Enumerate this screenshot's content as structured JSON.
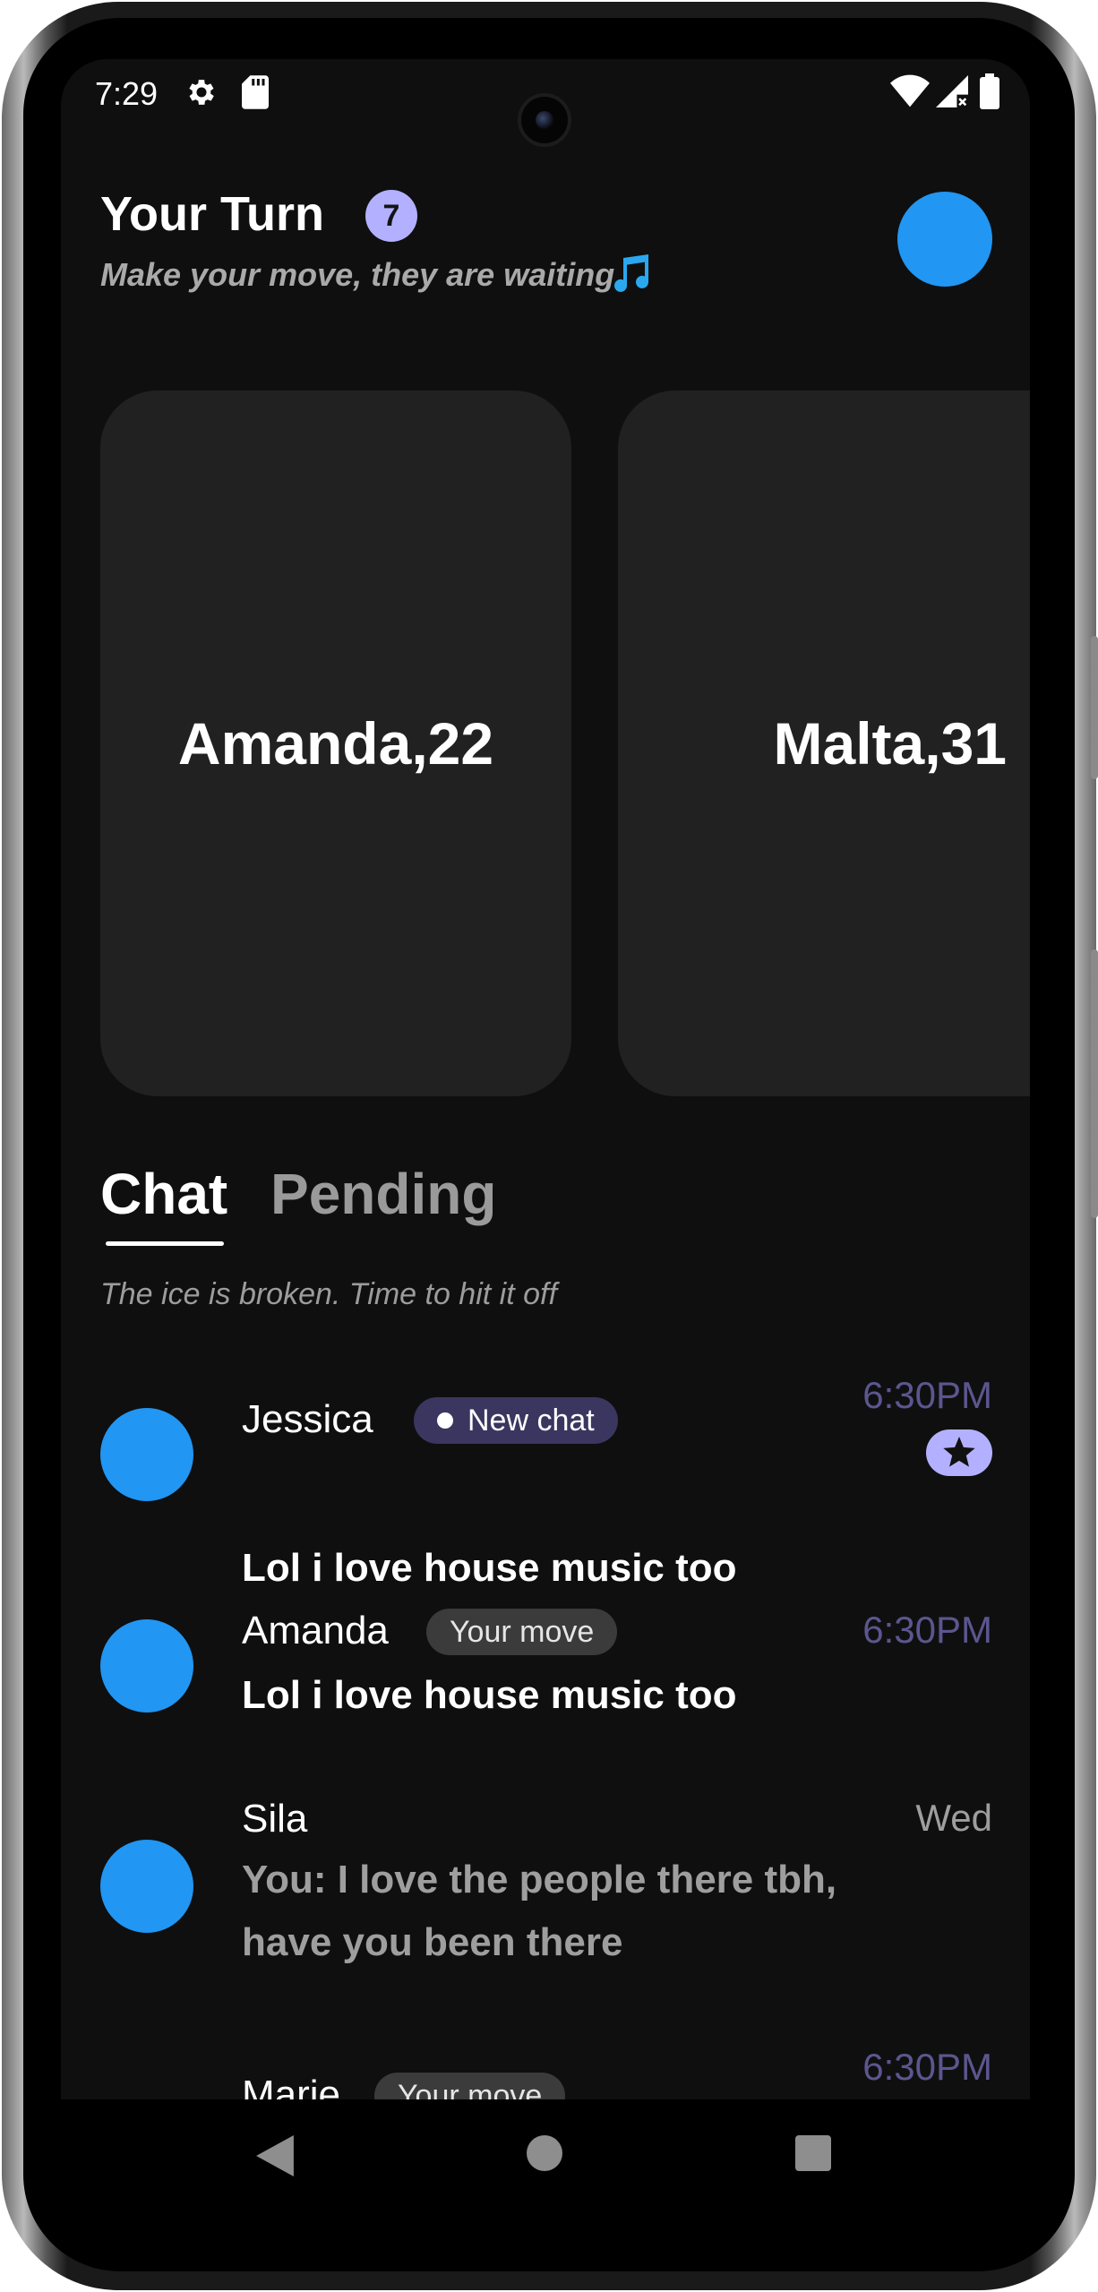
{
  "status_bar": {
    "time": "7:29",
    "icons": [
      "settings-gear-icon",
      "sd-card-icon",
      "wifi-icon",
      "cellular-signal-icon",
      "battery-icon"
    ]
  },
  "header": {
    "title": "Your Turn",
    "count": "7",
    "subtitle": "Make your move, they are waiting",
    "subtitle_icon": "music-note-icon"
  },
  "cards": [
    {
      "name": "Amanda,22"
    },
    {
      "name": "Malta,31"
    }
  ],
  "tabs": {
    "chat": "Chat",
    "pending": "Pending",
    "active": "Chat",
    "hint": "The ice is broken. Time to hit it off"
  },
  "chats": [
    {
      "name": "Jessica",
      "badge": "New chat",
      "message": "Lol i love house music too",
      "time": "6:30PM",
      "starred": true
    },
    {
      "name": "Amanda",
      "badge": "Your move",
      "message": "Lol i love house music too",
      "time": "6:30PM"
    },
    {
      "name": "Sila",
      "message_line1": "You: I love the people there tbh,",
      "message_line2": "have you been there",
      "time": "Wed"
    },
    {
      "name": "Marie",
      "badge": "Your move",
      "time": "6:30PM"
    }
  ],
  "colors": {
    "accent_blue": "#2196f3",
    "badge_lavender": "#b3b0ff",
    "time_purple": "#5b568f",
    "background": "#0f0f0f",
    "card": "#212121"
  },
  "nav": {
    "back": "back-icon",
    "home": "home-icon",
    "recents": "recents-icon"
  }
}
